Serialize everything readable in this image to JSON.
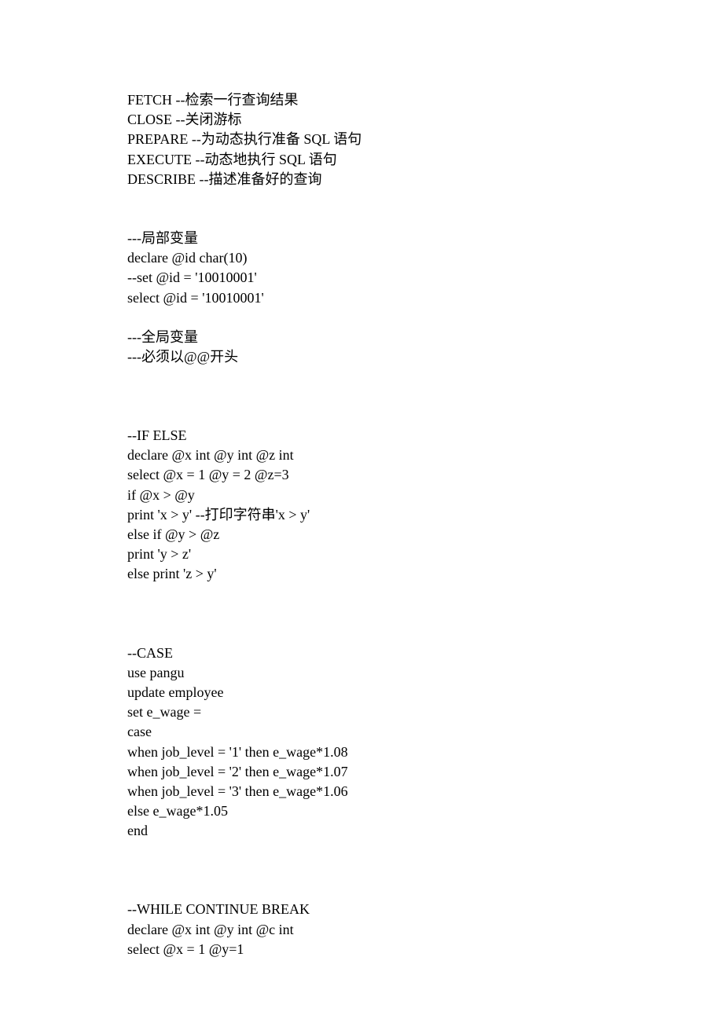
{
  "lines": {
    "l1": "FETCH --检索一行查询结果",
    "l2": "CLOSE --关闭游标",
    "l3": "PREPARE --为动态执行准备 SQL 语句",
    "l4": "EXECUTE --动态地执行 SQL 语句",
    "l5": "DESCRIBE --描述准备好的查询",
    "l6": "---局部变量",
    "l7": "declare @id char(10)",
    "l8": "--set @id = '10010001'",
    "l9": "select @id = '10010001'",
    "l10": "---全局变量",
    "l11": "---必须以@@开头",
    "l12": "--IF ELSE",
    "l13": "declare @x int @y int @z int",
    "l14": "select @x = 1 @y = 2 @z=3",
    "l15": "if @x > @y",
    "l16": "print 'x > y' --打印字符串'x > y'",
    "l17": "else if @y > @z",
    "l18": "print 'y > z'",
    "l19": "else print 'z > y'",
    "l20": "--CASE",
    "l21": "use pangu",
    "l22": "update employee",
    "l23": "set e_wage =",
    "l24": "case",
    "l25": "when job_level = '1' then e_wage*1.08",
    "l26": "when job_level = '2' then e_wage*1.07",
    "l27": "when job_level = '3' then e_wage*1.06",
    "l28": "else e_wage*1.05",
    "l29": "end",
    "l30": "--WHILE CONTINUE BREAK",
    "l31": "declare @x int @y int @c int",
    "l32": "select @x = 1 @y=1"
  }
}
